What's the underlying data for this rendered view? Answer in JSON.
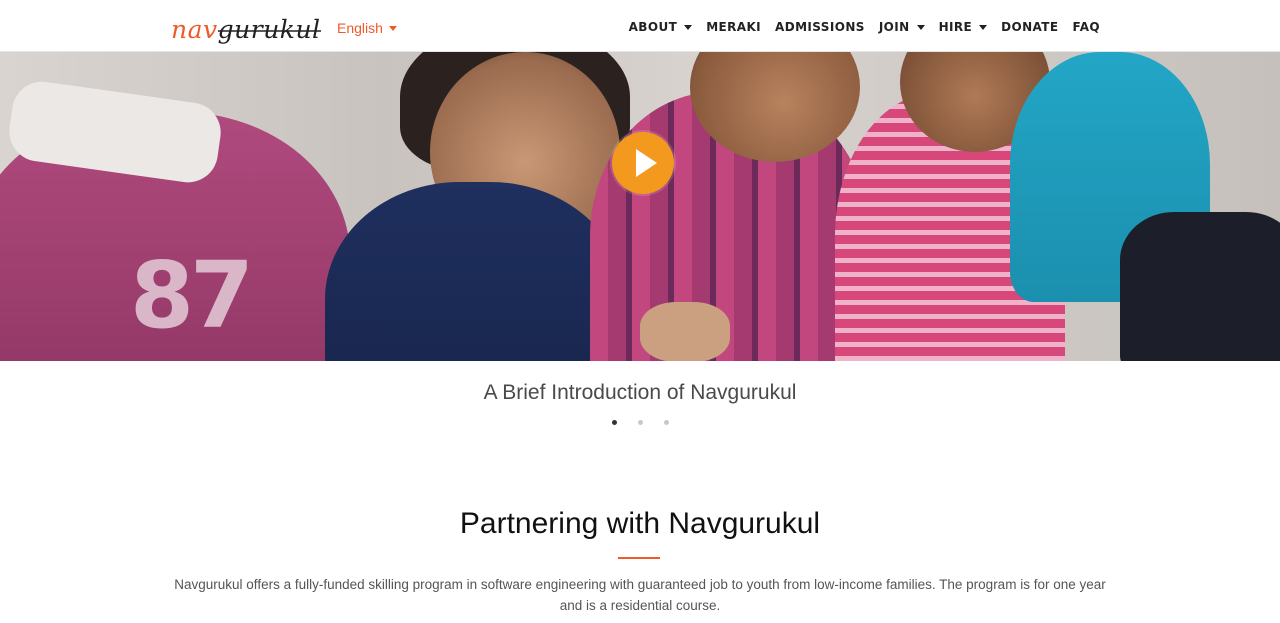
{
  "header": {
    "logo": {
      "part1": "nav",
      "part2": "gurukul"
    },
    "language": "English",
    "menu": [
      {
        "label": "ABOUT",
        "dropdown": true
      },
      {
        "label": "MERAKI",
        "dropdown": false
      },
      {
        "label": "ADMISSIONS",
        "dropdown": false
      },
      {
        "label": "JOIN",
        "dropdown": true
      },
      {
        "label": "HIRE",
        "dropdown": true
      },
      {
        "label": "DONATE",
        "dropdown": false
      },
      {
        "label": "FAQ",
        "dropdown": false
      }
    ]
  },
  "hero": {
    "caption": "A Brief Introduction of Navgurukul",
    "slides_total": 3,
    "active_slide": 1,
    "play_icon": "play-icon"
  },
  "partnering": {
    "title": "Partnering with Navgurukul",
    "description": "Navgurukul offers a fully-funded skilling program in software engineering with guaranteed job to youth from low-income families. The program is for one year and is a residential course."
  },
  "colors": {
    "accent": "#f05a2a",
    "play_button": "#f39a1e"
  }
}
